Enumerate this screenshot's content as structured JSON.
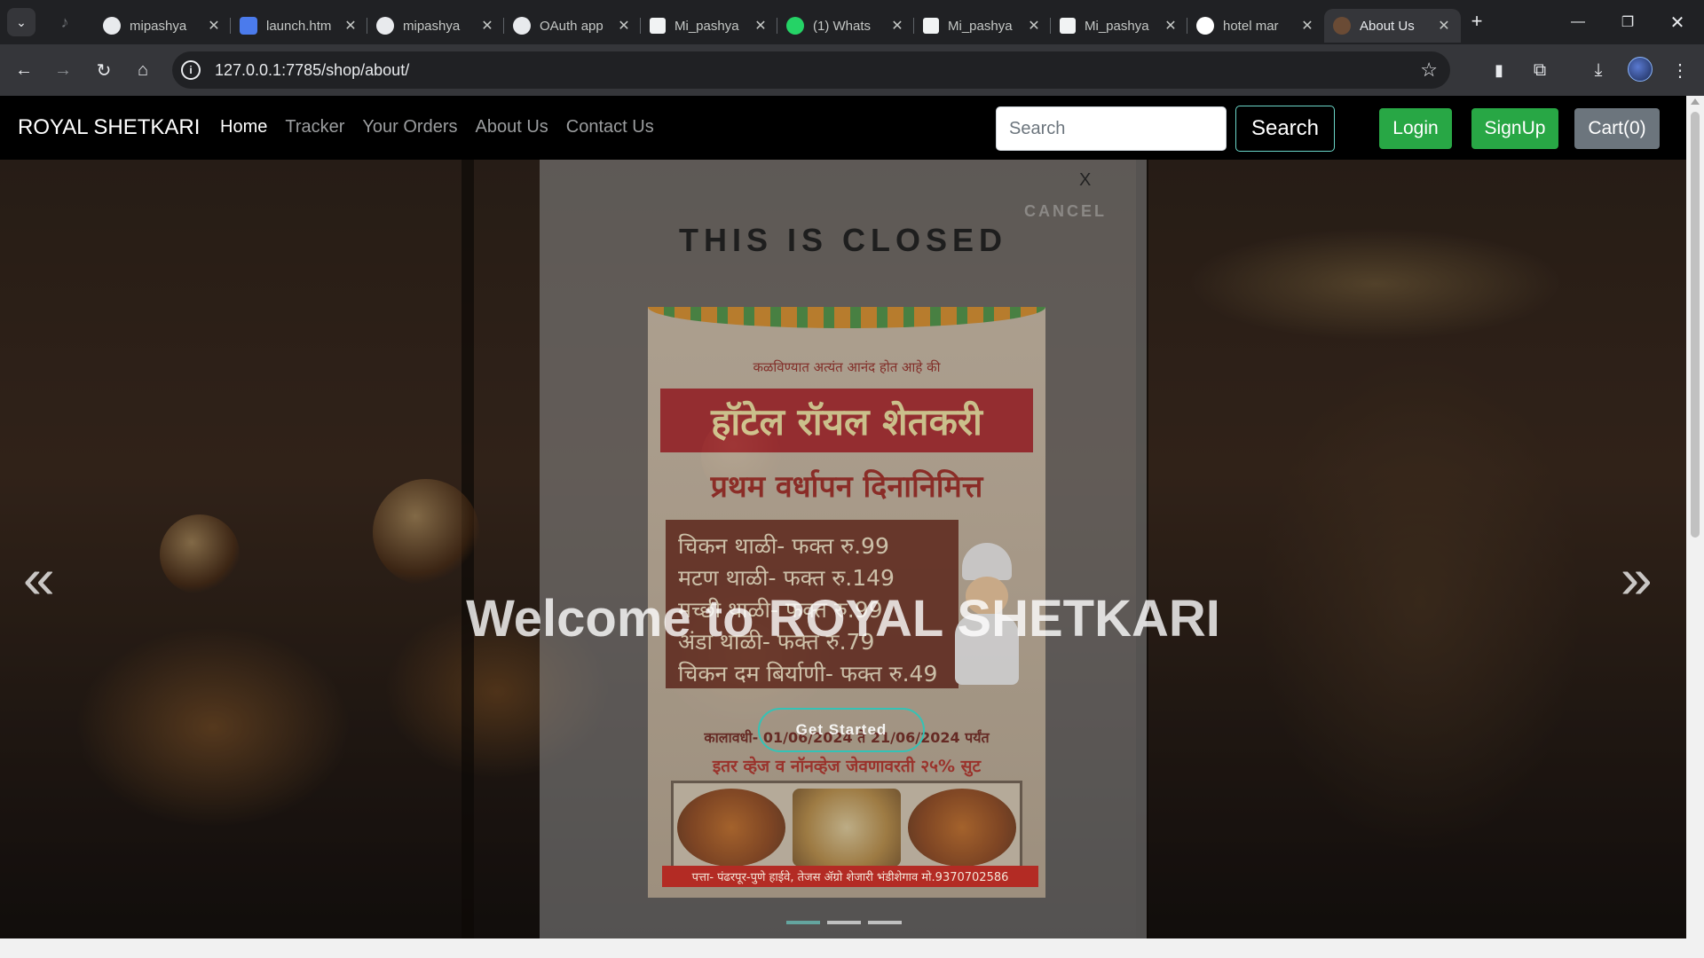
{
  "browser": {
    "tabs": [
      {
        "title": "mipashya",
        "icon": "github-icon",
        "fav": "gh"
      },
      {
        "title": "launch.htm",
        "icon": "app-icon",
        "fav": "cat"
      },
      {
        "title": "mipashya",
        "icon": "github-icon",
        "fav": "gh"
      },
      {
        "title": "OAuth app",
        "icon": "github-icon",
        "fav": "gh"
      },
      {
        "title": "Mi_pashya",
        "icon": "site-icon",
        "fav": "mi"
      },
      {
        "title": "(1) Whats",
        "icon": "whatsapp-icon",
        "fav": "wa"
      },
      {
        "title": "Mi_pashya",
        "icon": "site-icon",
        "fav": "mi"
      },
      {
        "title": "Mi_pashya",
        "icon": "site-icon",
        "fav": "mi"
      },
      {
        "title": "hotel mar",
        "icon": "google-icon",
        "fav": "goog"
      },
      {
        "title": "About Us",
        "icon": "restaurant-icon",
        "fav": "rs",
        "active": true
      }
    ],
    "url": "127.0.0.1:7785/shop/about/"
  },
  "navbar": {
    "brand": "ROYAL SHETKARI",
    "links": [
      "Home",
      "Tracker",
      "Your Orders",
      "About Us",
      "Contact Us"
    ],
    "active_link": "Home",
    "search_placeholder": "Search",
    "search_button": "Search",
    "login": "Login",
    "signup": "SignUp",
    "cart": "Cart(0)"
  },
  "modal": {
    "close": "X",
    "cancel": "CANCEL",
    "heading": "THIS IS CLOSED"
  },
  "poster": {
    "tagline": "कळविण्यात अत्यंत आनंद होत आहे की",
    "hotel_name": "हॉटेल रॉयल शेतकरी",
    "occasion": "प्रथम वर्धापन दिनानिमित्त",
    "menu": [
      "चिकन थाळी- फक्त रु.99",
      "मटण थाळी- फक्त रु.149",
      "मच्छी थाळी- फक्त रु.99",
      "अंडा थाळी- फक्त रु.79",
      "चिकन दम बिर्याणी- फक्त रु.49"
    ],
    "dates": "कालावधी- 01/06/2024 ते 21/06/2024 पर्यंत",
    "offer": "इतर व्हेज व नॉनव्हेज जेवणावरती २५% सुट",
    "address": "पत्ता- पंढरपूर-पुणे हाईवे, तेजस ॲग्रो शेजारी भंडीशेगाव मो.9370702586"
  },
  "hero": {
    "title": "Welcome to ROYAL SHETKARI",
    "cta": "Get Started",
    "slides": 3,
    "active_slide": 1
  },
  "colors": {
    "accent": "#34c3b6",
    "success": "#28a745",
    "secondary": "#6c757d"
  }
}
